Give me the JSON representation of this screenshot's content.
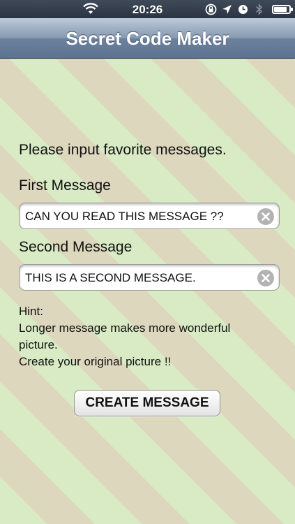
{
  "status_bar": {
    "time": "20:26",
    "icons": [
      "wifi-icon",
      "rotation-lock-icon",
      "location-icon",
      "alarm-icon",
      "bluetooth-icon",
      "battery-icon"
    ]
  },
  "nav_bar": {
    "title": "Secret Code Maker"
  },
  "form": {
    "prompt": "Please input favorite messages.",
    "first_label": "First Message",
    "first_value": "CAN YOU READ THIS MESSAGE ??",
    "second_label": "Second Message",
    "second_value": "THIS IS A SECOND MESSAGE.",
    "hint_lines": [
      "Hint:",
      "Longer message makes more wonderful",
      "picture.",
      "Create your original picture !!"
    ],
    "create_label": "CREATE MESSAGE"
  },
  "colors": {
    "stripe_green": "#d8ebc4",
    "stripe_tan": "#ddd7bd",
    "nav_bar": "#7c8fa8"
  }
}
